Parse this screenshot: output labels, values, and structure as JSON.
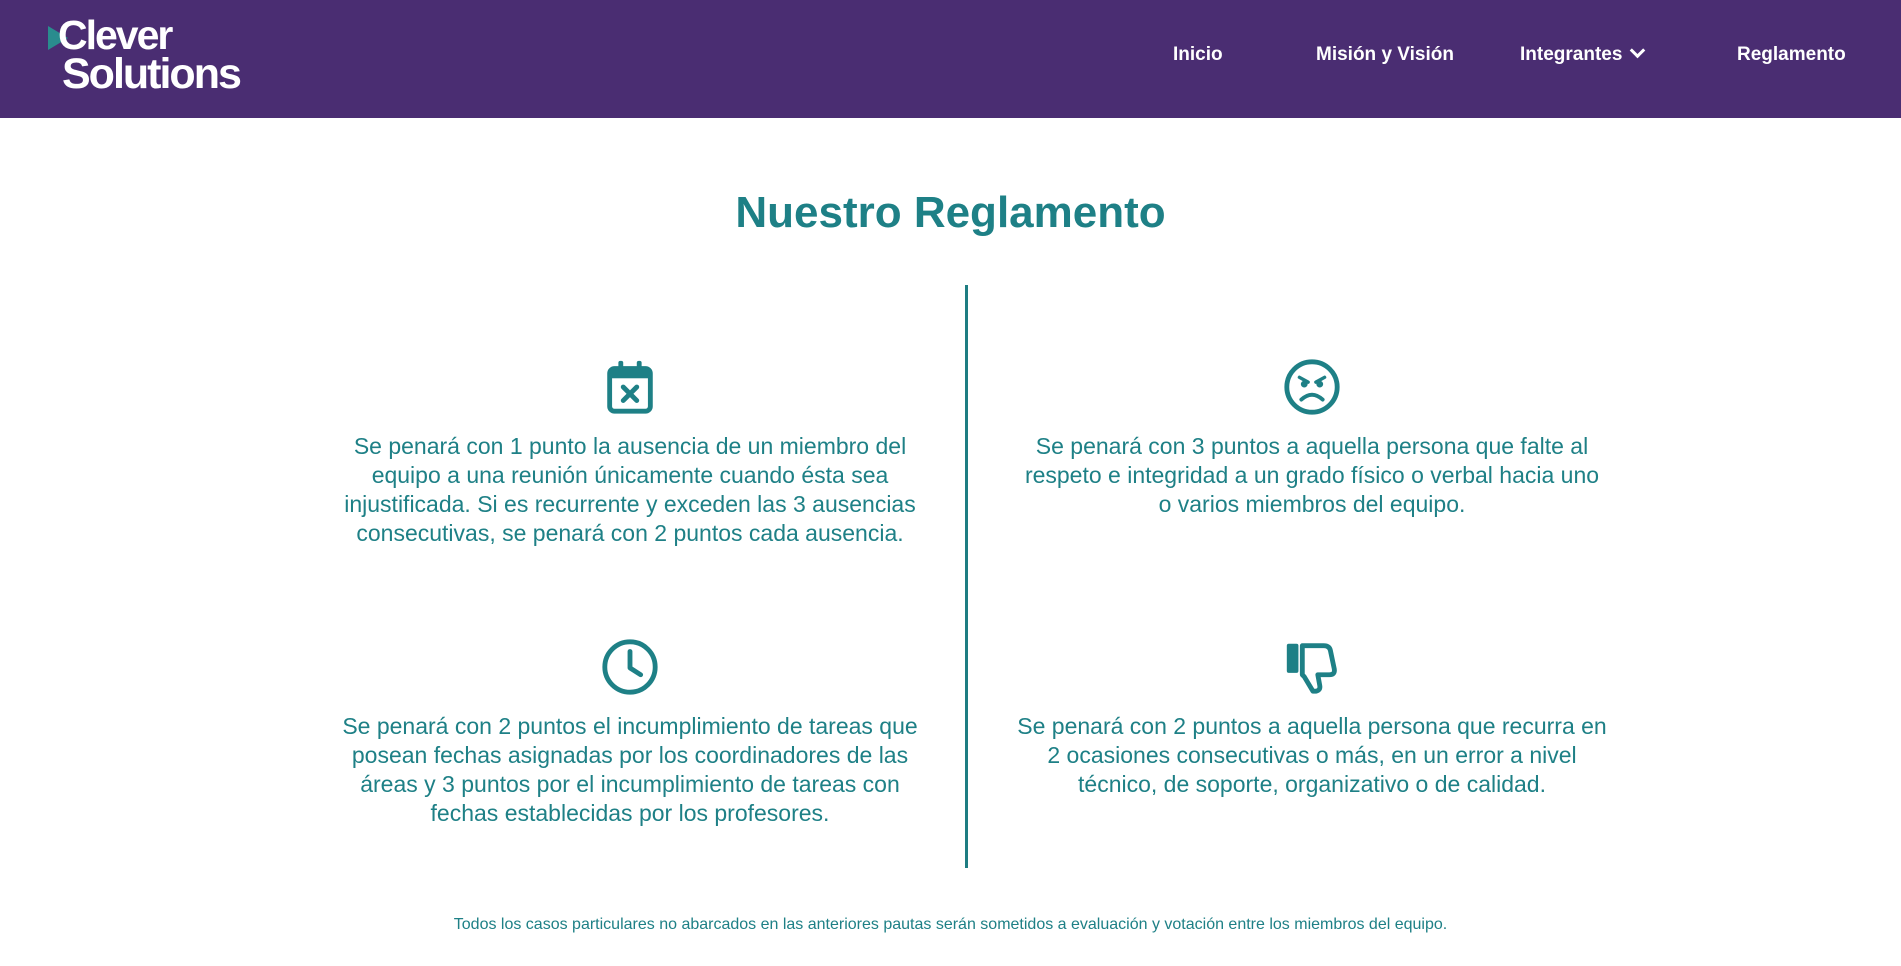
{
  "brand": {
    "line1": "Clever",
    "line2": "Solutions"
  },
  "nav": {
    "items": [
      {
        "label": "Inicio"
      },
      {
        "label": "Misión y Visión"
      },
      {
        "label": "Integrantes",
        "icon": "chevron-down-icon"
      },
      {
        "label": "Reglamento"
      }
    ]
  },
  "page": {
    "title": "Nuestro Reglamento"
  },
  "rules": [
    {
      "icon": "calendar-x-icon",
      "text": "Se penará con 1 punto la ausencia de un miembro del equipo a una reunión únicamente cuando ésta sea injustificada. Si es recurrente y exceden las 3 ausencias consecutivas, se penará con 2 puntos cada ausencia."
    },
    {
      "icon": "angry-face-icon",
      "text": "Se penará con 3 puntos a aquella persona que falte al respeto e integridad a un grado físico o verbal hacia uno o varios miembros del equipo."
    },
    {
      "icon": "clock-icon",
      "text": "Se penará con 2 puntos el incumplimiento de tareas que posean fechas asignadas por los coordinadores de las áreas y 3 puntos por el incumplimiento de tareas con fechas establecidas por los profesores."
    },
    {
      "icon": "thumbs-down-icon",
      "text": "Se penará con 2 puntos a aquella persona que recurra en 2 ocasiones consecutivas o más, en un error a nivel técnico, de soporte, organizativo o de calidad."
    }
  ],
  "footer": {
    "note": "Todos los casos particulares no abarcados en las anteriores pautas serán sometidos a evaluación y votación entre los miembros del equipo."
  },
  "colors": {
    "navbar": "#4a2d72",
    "accent": "#1e8086",
    "logo_mark": "#2a8c8e",
    "background": "#ffffff"
  }
}
